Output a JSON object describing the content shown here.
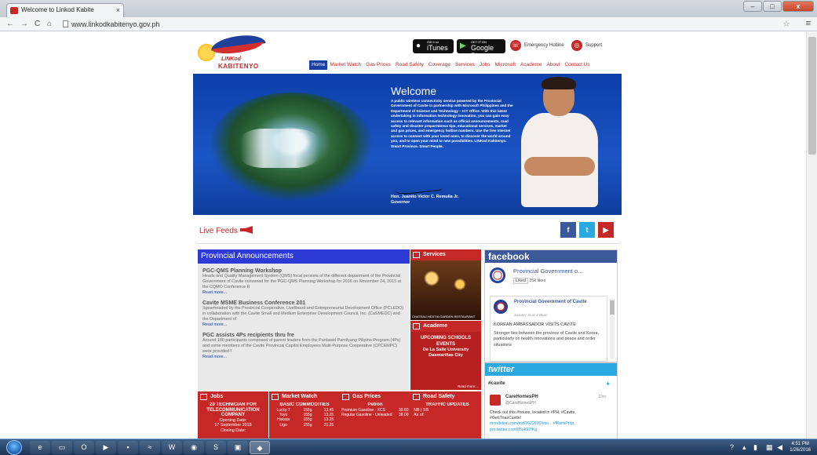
{
  "browser": {
    "tab_title": "Welcome to Linkod Kabite",
    "url": "www.linkodkabitenyo.gov.ph",
    "back": "←",
    "forward": "→",
    "reload": "C",
    "home": "⌂"
  },
  "header": {
    "logo_line1": "LINKod",
    "logo_line2": "KABITENYO",
    "itunes_small": "Get it on",
    "itunes": "iTunes",
    "gplay_small": "GET IT ON",
    "gplay": "Google Play",
    "emergency": "Emergency Hotline",
    "support": "Support"
  },
  "nav": [
    "Home",
    "Market Watch",
    "Gas Prices",
    "Road Safety",
    "Coverage",
    "Services",
    "Jobs",
    "Microsoft",
    "Academe",
    "About",
    "Contact Us"
  ],
  "hero": {
    "title": "Welcome",
    "text": "A public wireless connectivity service powered by the Provincial Government of Cavite in partnership with Microsoft Philippines and the Department of Science and Technology – ICT Office. With this latest undertaking in information technology innovation, you can gain easy access to relevant information such as official announcements, road safety and disaster preparedness tips, educational services, market and gas prices, and emergency hotline numbers. Use the free internet access to connect with your loved ones, to discover the world around you, and to open your mind to new possibilities. LINKod Kabitenyo. Smart Province. Smart People.",
    "governor_name": "Hon. Juanito Victor C. Remulla Jr.",
    "governor_title": "Governor"
  },
  "live_feeds": "Live Feeds",
  "social": {
    "facebook": "f",
    "twitter": "t",
    "youtube": "▶"
  },
  "announcements": {
    "title": "Provincial Announcements",
    "items": [
      {
        "title": "PGC-QMS Planning Workshop",
        "body": "Heads and Quality Management System (QMS) focal persons of the different department of the Provincial Government of Cavite convened for the PGC-QMS Planning Workshop for 2016 on November 24, 2015 at the CQMO Conference R",
        "more": "Read more..."
      },
      {
        "title": "Cavite MSME Business Conference 201",
        "body": "Spearheaded by the Provincial Cooperative, Livelihood and Entrepreneurial Development Office (PCLEDO) in collaboration with the Cavite Small and Medium Enterprise Development Council, Inc. (CaSMEDC) and the Department of",
        "more": "Read more..."
      },
      {
        "title": "PGC assists 4Ps recipients thru fre",
        "body": "Around 180 participants composed of parent leaders from the Pantawid Pamilyang Pilipino Program (4Ps) and some members of the Cavite Provincial Capitol Employees Multi-Purpose Cooperative (CPCEMPC) were provided f",
        "more": "Read more..."
      }
    ]
  },
  "services": {
    "title": "Services",
    "caption": "CHATEAU HESTIA GARDEN RESTAURANT"
  },
  "academe": {
    "title": "Academe",
    "line1": "UPCOMING SCHOOLS",
    "line2": "EVENTS",
    "line3": "De La Salle University Dasmariñas City",
    "more": "Read more..."
  },
  "facebook": {
    "title": "facebook",
    "page_name": "Provincial Government o...",
    "liked": "Liked",
    "likes": "35k likes",
    "post_author": "Provincial Government of Cavite",
    "post_date": "January 15 at 4:28pm",
    "post_heading": "KOREAN AMBASSADOR VISITS CAVITE",
    "post_body": "Stronger ties between the province of Cavite and Korea, particularly on health innovations and peace and order situations"
  },
  "twitter": {
    "title": "twitter",
    "hashtag": "#cavite",
    "name": "CareHomesPH",
    "handle": "@CareHomesPH",
    "time": "19m",
    "text": "Check out this #house, located in #PH, #Cavite, #GenTriasCavite!",
    "link": "mondelion.com/md/2622690/vso... #MamiProp pro.twitter.com/05uk97fKg"
  },
  "jobs": {
    "title": "Jobs",
    "company": "20 TECHNICIAN FOR TELECOMMUNICATION COMPANY",
    "opening_label": "Opening Date:",
    "opening": "17 September 2015",
    "closing_label": "Closing Date:"
  },
  "market": {
    "title": "Market Watch",
    "sub": "BASIC COMMODITIES",
    "rows": [
      [
        "Lucky 7",
        "155g",
        "13.45"
      ],
      [
        "Toyo",
        "155g",
        "13.25"
      ],
      [
        "Hakata",
        "155g",
        "13.25"
      ],
      [
        "Ligo",
        "155g",
        "21.25"
      ]
    ]
  },
  "gas": {
    "title": "Gas Prices",
    "sub": "Petron",
    "rows": [
      [
        "Premium Gasoline - XCS",
        "39.80"
      ],
      [
        "Regular Gasoline - Unleaded",
        "38.00"
      ]
    ]
  },
  "road": {
    "title": "Road Safety",
    "sub": "TRAFFIC UPDATES",
    "line": "NB | SB",
    "asof": "As of:"
  },
  "taskbar": {
    "time": "4:51 PM",
    "date": "1/26/2016"
  }
}
